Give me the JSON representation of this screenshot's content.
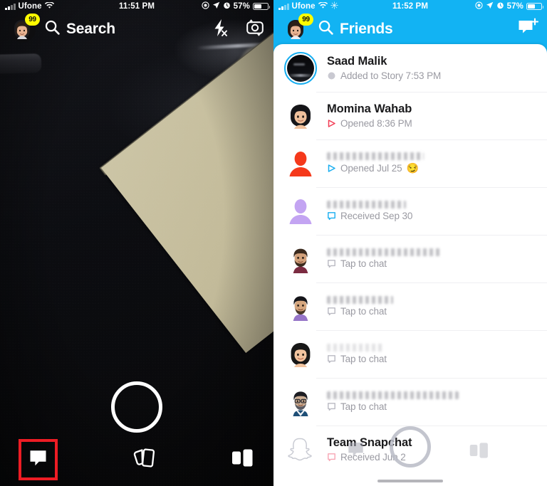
{
  "left_panel": {
    "status_bar": {
      "carrier": "Ufone",
      "wifi_icon": "wifi-icon",
      "time": "11:51 PM",
      "battery_percent": "57%",
      "indicators": [
        "screen-record-icon",
        "location-arrow-icon",
        "alarm-clock-icon"
      ]
    },
    "top_bar": {
      "avatar": {
        "name": "profile-bitmoji-avatar",
        "badge": "99"
      },
      "search_icon": "search-icon",
      "search_label": "Search",
      "flash_icon": "flash-off-icon",
      "flip_camera_icon": "camera-flip-icon"
    },
    "camera": {
      "shutter_button": "shutter-button",
      "description": "dark textured surface with beige board"
    },
    "bottom_bar": {
      "chat_icon": "chat-bubble-icon",
      "chat_highlighted": true,
      "highlight_color": "#ED1C24",
      "stories_icon": "stories-cards-icon",
      "discover_icon": "discover-icon"
    }
  },
  "right_panel": {
    "status_bar": {
      "carrier": "Ufone",
      "wifi_icon": "wifi-icon",
      "weather_icon": "sun-icon",
      "time": "11:52 PM",
      "battery_percent": "57%",
      "indicators": [
        "screen-record-icon",
        "location-arrow-icon",
        "alarm-clock-icon"
      ]
    },
    "header": {
      "avatar": {
        "name": "profile-bitmoji-avatar",
        "badge": "99"
      },
      "search_icon": "search-icon",
      "title": "Friends",
      "new_chat_icon": "new-chat-icon",
      "accent_color": "#12B3F3"
    },
    "friends": [
      {
        "name": "Saad Malik",
        "name_visible": true,
        "status": "Added to Story 7:53 PM",
        "status_icon": "story-icon",
        "status_color": "#9A9AA2",
        "avatar_type": "story-thumbnail",
        "has_story_ring": true,
        "emoji": ""
      },
      {
        "name": "Momina Wahab",
        "name_visible": true,
        "status": "Opened 8:36 PM",
        "status_icon": "opened-snap-icon",
        "status_color": "#F23C54",
        "avatar_type": "bitmoji-female-dark-hair",
        "has_story_ring": false,
        "emoji": ""
      },
      {
        "name": "",
        "name_visible": false,
        "status": "Opened Jul 25",
        "status_icon": "opened-snap-icon",
        "status_color": "#18AEF0",
        "avatar_type": "placeholder-orange",
        "has_story_ring": false,
        "emoji": "😏"
      },
      {
        "name": "",
        "name_visible": false,
        "status": "Received Sep 30",
        "status_icon": "received-chat-icon",
        "status_color": "#18AEF0",
        "avatar_type": "placeholder-purple",
        "has_story_ring": false,
        "emoji": ""
      },
      {
        "name": "",
        "name_visible": false,
        "status": "Tap to chat",
        "status_icon": "chat-outline-icon",
        "status_color": "#9A9AA2",
        "avatar_type": "bitmoji-bearded-maroon",
        "has_story_ring": false,
        "emoji": ""
      },
      {
        "name": "",
        "name_visible": false,
        "status": "Tap to chat",
        "status_icon": "chat-outline-icon",
        "status_color": "#9A9AA2",
        "avatar_type": "bitmoji-bearded-purple",
        "has_story_ring": false,
        "emoji": ""
      },
      {
        "name": "",
        "name_visible": false,
        "status": "Tap to chat",
        "status_icon": "chat-outline-icon",
        "status_color": "#9A9AA2",
        "avatar_type": "bitmoji-female-bob",
        "has_story_ring": false,
        "emoji": ""
      },
      {
        "name": "",
        "name_visible": false,
        "status": "Tap to chat",
        "status_icon": "chat-outline-icon",
        "status_color": "#9A9AA2",
        "avatar_type": "bitmoji-bearded-glasses",
        "has_story_ring": false,
        "emoji": ""
      },
      {
        "name": "Team Snapchat",
        "name_visible": true,
        "status": "Received Jun 2",
        "status_icon": "received-chat-icon",
        "status_color": "#F7A6B4",
        "avatar_type": "snapchat-ghost",
        "has_story_ring": false,
        "emoji": ""
      }
    ],
    "ghost_overlay": {
      "shutter_button": "shutter-button-ghost",
      "chat_icon": "chat-bubble-icon-ghost",
      "stories_icon": "stories-cards-icon-ghost"
    }
  }
}
